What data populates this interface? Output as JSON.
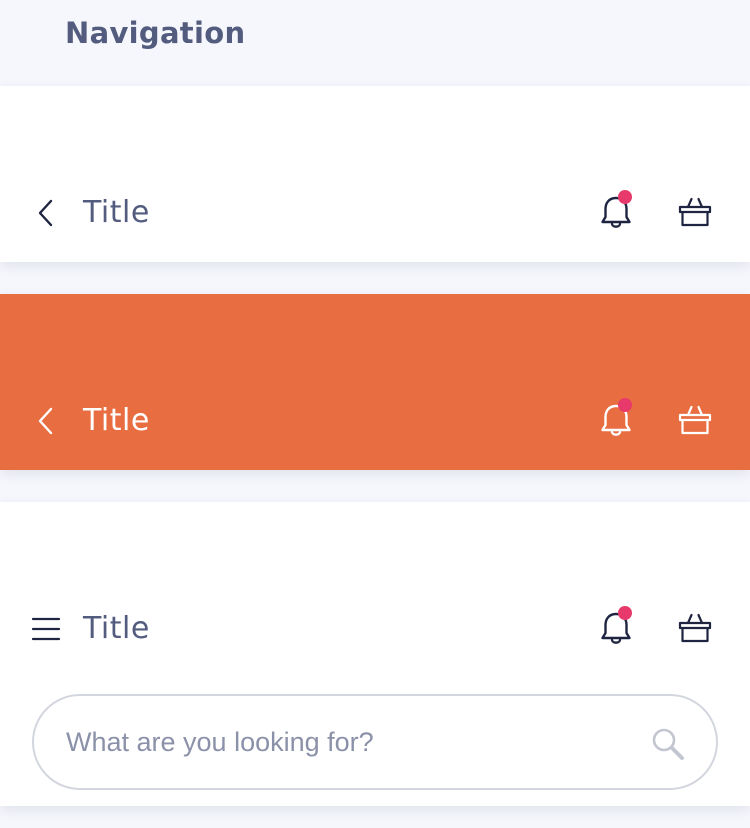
{
  "section": {
    "heading": "Navigation"
  },
  "navbars": [
    {
      "variant": "light",
      "title": "Title",
      "leading_icon": "chevron-left-icon",
      "actions": [
        "bell-icon",
        "basket-icon"
      ],
      "notification_badge": true
    },
    {
      "variant": "accent",
      "title": "Title",
      "leading_icon": "chevron-left-icon",
      "actions": [
        "bell-icon",
        "basket-icon"
      ],
      "notification_badge": true
    },
    {
      "variant": "light",
      "title": "Title",
      "leading_icon": "menu-icon",
      "actions": [
        "bell-icon",
        "basket-icon"
      ],
      "notification_badge": true,
      "search": {
        "placeholder": "What are you looking for?",
        "icon": "search-icon"
      }
    }
  ],
  "colors": {
    "page_background": "#f6f7fc",
    "text_primary": "#535c7e",
    "icon_dark": "#1f2540",
    "accent": "#e86e42",
    "badge": "#e8396b",
    "search_border": "#d3d6de",
    "placeholder": "#8a91a8"
  }
}
